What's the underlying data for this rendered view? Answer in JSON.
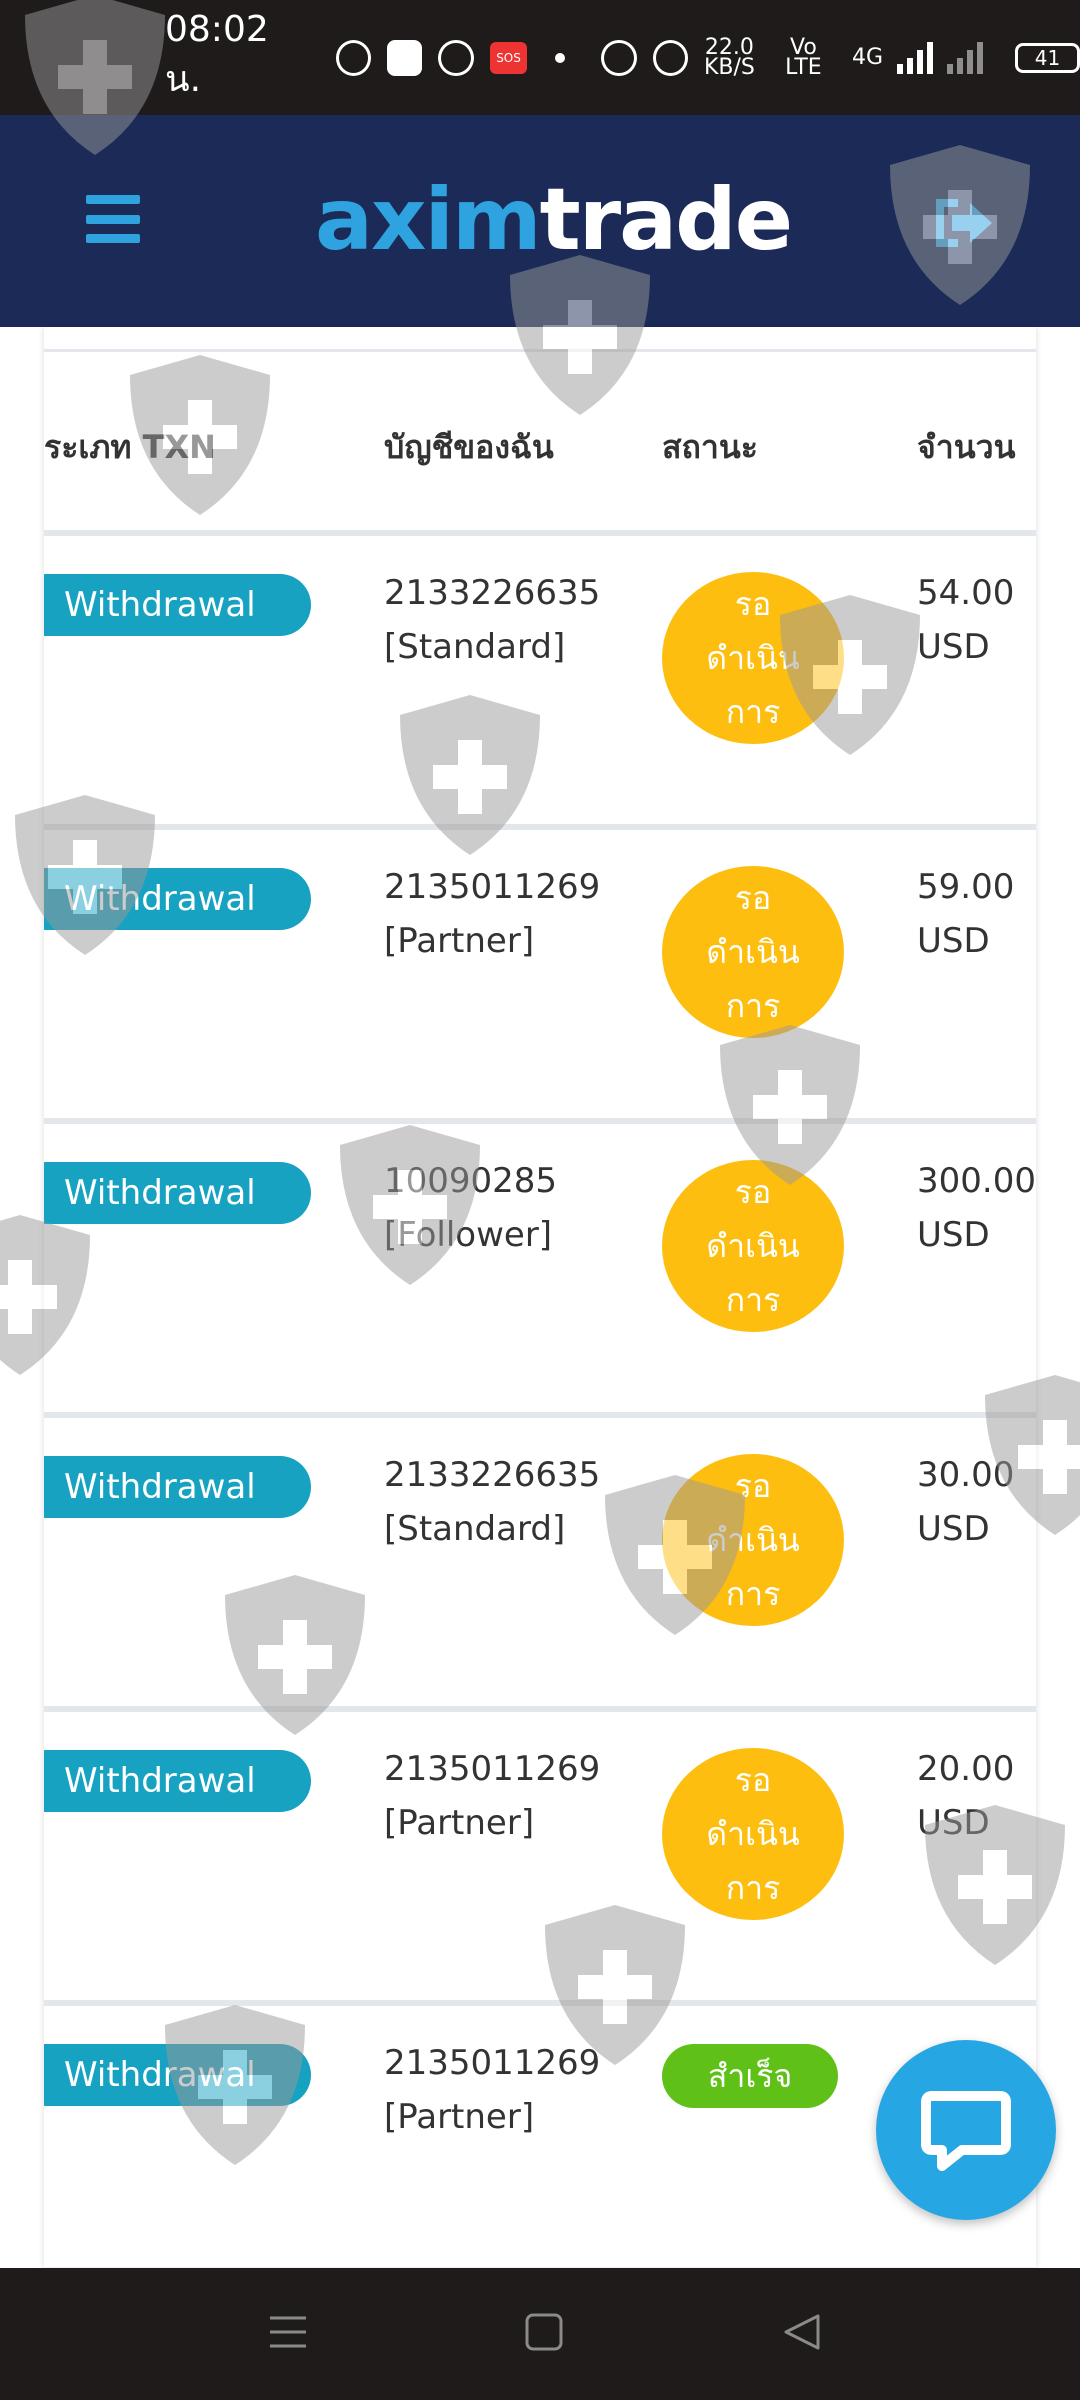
{
  "status_bar": {
    "time": "08:02 น.",
    "network_speed": "22.0",
    "network_speed_unit": "KB/S",
    "volte": "Vo LTE",
    "network_type": "4G",
    "battery": "41"
  },
  "header": {
    "logo_part1": "axim",
    "logo_part2": "trade",
    "menu_icon": "hamburger-icon",
    "logout_icon": "logout-icon"
  },
  "table": {
    "columns": [
      "ระเภท TXN",
      "บัญชีของฉัน",
      "สถานะ",
      "จำนวน"
    ],
    "rows": [
      {
        "type": "Withdrawal",
        "account": "2133226635",
        "account_type": "[Standard]",
        "status": "รอดำเนินการ",
        "status_lines": [
          "รอ",
          "ดำเนิน",
          "การ"
        ],
        "amount": "54.00",
        "currency": "USD"
      },
      {
        "type": "Withdrawal",
        "account": "2135011269",
        "account_type": "[Partner]",
        "status": "รอดำเนินการ",
        "status_lines": [
          "รอ",
          "ดำเนิน",
          "การ"
        ],
        "amount": "59.00",
        "currency": "USD"
      },
      {
        "type": "Withdrawal",
        "account": "10090285",
        "account_type": "[Follower]",
        "status": "รอดำเนินการ",
        "status_lines": [
          "รอ",
          "ดำเนิน",
          "การ"
        ],
        "amount": "300.00",
        "currency": "USD"
      },
      {
        "type": "Withdrawal",
        "account": "2133226635",
        "account_type": "[Standard]",
        "status": "รอดำเนินการ",
        "status_lines": [
          "รอ",
          "ดำเนิน",
          "การ"
        ],
        "amount": "30.00",
        "currency": "USD"
      },
      {
        "type": "Withdrawal",
        "account": "2135011269",
        "account_type": "[Partner]",
        "status": "รอดำเนินการ",
        "status_lines": [
          "รอ",
          "ดำเนิน",
          "การ"
        ],
        "amount": "20.00",
        "currency": "USD"
      },
      {
        "type": "Withdrawal",
        "account": "2135011269",
        "account_type": "[Partner]",
        "status": "สำเร็จ",
        "amount": "",
        "currency": ""
      }
    ]
  },
  "colors": {
    "navbar": "#1b2a57",
    "accent": "#2fa3e0",
    "type_badge": "#17a2c2",
    "pending": "#fdbe0f",
    "success": "#5fc117"
  },
  "chat_button_icon": "chat-bubble-icon",
  "system_nav": {
    "menu": "recent-apps-icon",
    "home": "home-icon",
    "back": "back-icon"
  }
}
